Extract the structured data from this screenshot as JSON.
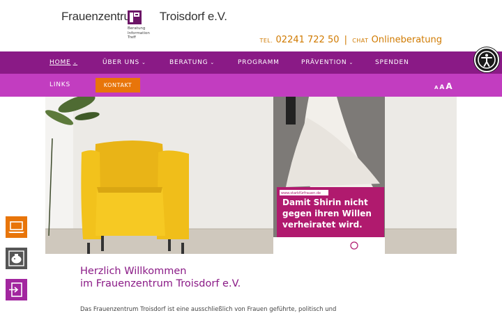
{
  "logo": {
    "name_part1": "Frauenzentrum",
    "name_part2": "Troisdorf e.V.",
    "tagline": [
      "Beratung",
      "Information",
      "Treff"
    ]
  },
  "contact": {
    "tel_label": "TEL.",
    "phone": "02241 722 50",
    "separator": "|",
    "chat_label": "CHAT",
    "chat_link": "Onlineberatung"
  },
  "nav": {
    "primary": [
      {
        "label": "HOME",
        "dropdown": true,
        "active": true
      },
      {
        "label": "ÜBER UNS",
        "dropdown": true
      },
      {
        "label": "BERATUNG",
        "dropdown": true
      },
      {
        "label": "PROGRAMM",
        "dropdown": false
      },
      {
        "label": "PRÄVENTION",
        "dropdown": true
      },
      {
        "label": "SPENDEN",
        "dropdown": false
      }
    ],
    "secondary": {
      "links": "LINKS",
      "kontakt": "KONTAKT"
    },
    "font_size": [
      "A",
      "A",
      "A"
    ]
  },
  "hero": {
    "poster_url": "www.starkfürfrauen.de",
    "poster_headline": [
      "Damit Shirin nicht",
      "gegen ihren Willen",
      "verheiratet wird."
    ]
  },
  "welcome": {
    "line1": "Herzlich Willkommen",
    "line2": "im Frauenzentrum Troisdorf e.V."
  },
  "intro_text": "Das Frauenzentrum Troisdorf ist eine ausschließlich von Frauen geführte, politisch und",
  "colors": {
    "nav_primary": "#8a1a86",
    "nav_secondary": "#c23dc0",
    "accent_orange": "#e8750a",
    "contact_orange": "#d07a00"
  },
  "icons": [
    "accessibility-icon",
    "laptop-icon",
    "piggy-bank-icon",
    "exit-icon"
  ]
}
